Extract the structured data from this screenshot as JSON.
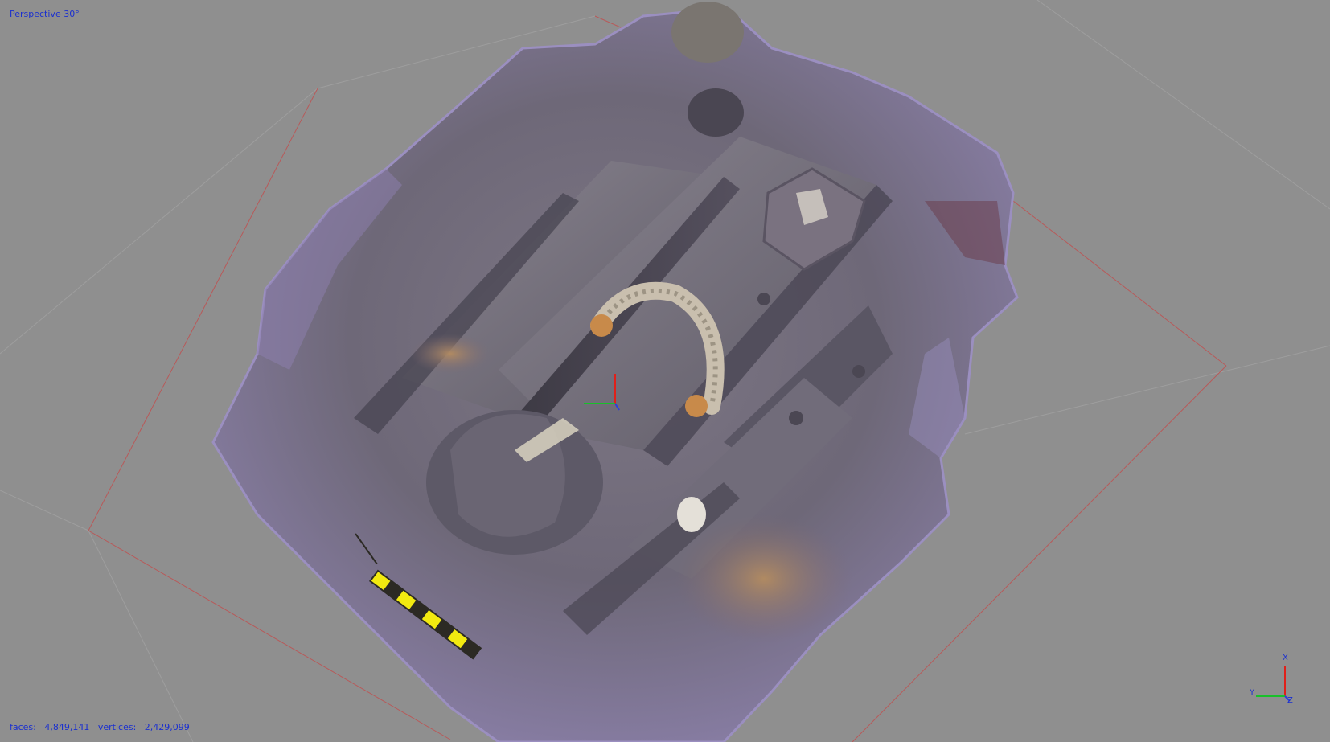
{
  "viewport": {
    "view_mode": "Perspective 30°",
    "stats": {
      "faces_label": "faces:",
      "faces_value": "4,849,141",
      "vertices_label": "vertices:",
      "vertices_value": "2,429,099"
    }
  },
  "axis_widget": {
    "x_label": "X",
    "y_label": "Y",
    "z_label": "Z"
  },
  "colors": {
    "background": "#8f8f8f",
    "hud_text": "#1a2fd0",
    "axis_x": "#e0201a",
    "axis_y": "#18c02a",
    "axis_z": "#2a3fe0",
    "bounding_box": "#c05050",
    "mesh_base": "#6f6a80",
    "scale_bar": "#f2ea10"
  },
  "icons": {
    "scale_bar": "photographic-scale-bar-icon",
    "pivot": "pivot-gizmo-icon",
    "orientation": "axis-orientation-icon"
  }
}
